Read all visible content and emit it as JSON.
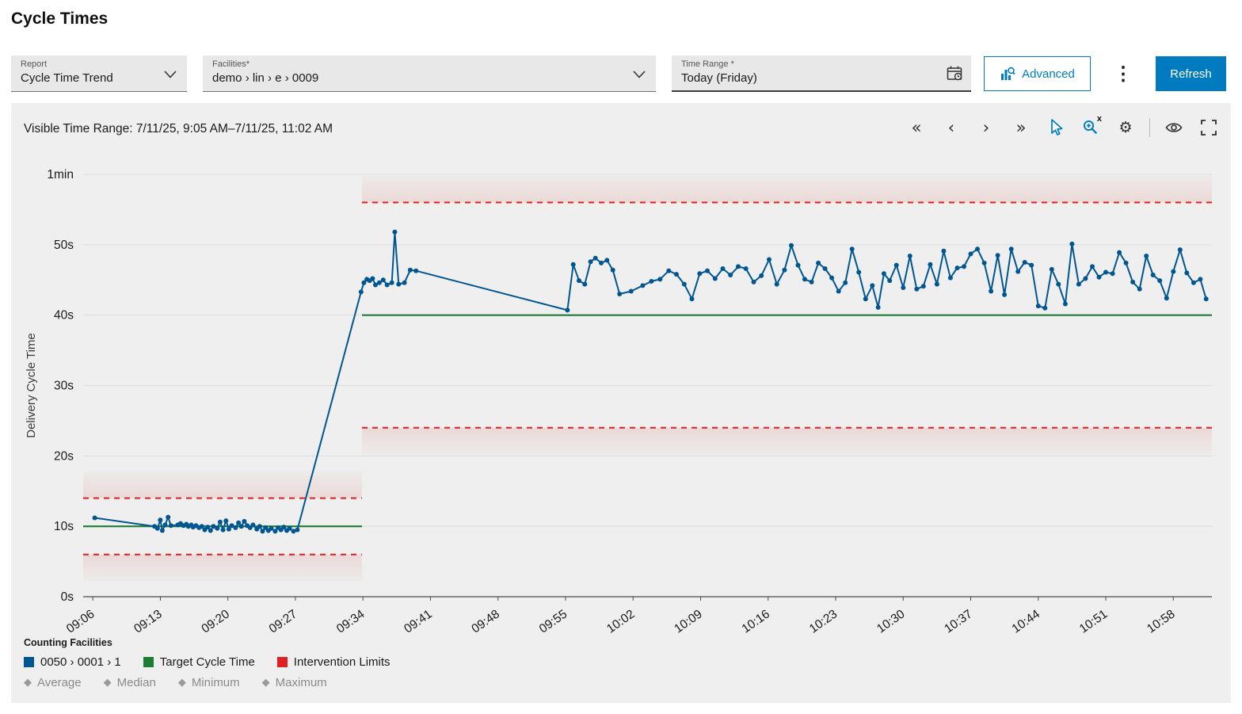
{
  "page": {
    "title": "Cycle Times"
  },
  "toolbar": {
    "report": {
      "label": "Report",
      "value": "Cycle Time Trend"
    },
    "facilities": {
      "label": "Facilities*",
      "value": "demo › lin › e › 0009"
    },
    "time_range": {
      "label": "Time Range *",
      "value": "Today (Friday)"
    },
    "advanced_label": "Advanced",
    "refresh_label": "Refresh"
  },
  "chart_header": {
    "visible_time_range": "Visible Time Range: 7/11/25, 9:05 AM–7/11/25, 11:02 AM"
  },
  "icons": {
    "pan_far_left": "«",
    "pan_left": "‹",
    "pan_right": "›",
    "pan_far_right": "»",
    "gear": "⚙",
    "more": "⋮",
    "zoom_sup": "x",
    "diamond": "◆"
  },
  "legend": {
    "title": "Counting Facilities",
    "series": [
      {
        "label": "0050 › 0001 › 1",
        "color": "#005691"
      },
      {
        "label": "Target Cycle Time",
        "color": "#1e7d34"
      },
      {
        "label": "Intervention Limits",
        "color": "#e02020"
      }
    ],
    "stats": [
      {
        "label": "Average"
      },
      {
        "label": "Median"
      },
      {
        "label": "Minimum"
      },
      {
        "label": "Maximum"
      }
    ]
  },
  "colors": {
    "series": "#005691",
    "target": "#1e7d34",
    "intervention": "#e02020",
    "grid": "#dcdcdc",
    "accent": "#007bc0",
    "panel_bg": "#efeff0"
  },
  "chart_data": {
    "type": "line",
    "title": "Cycle Time Trend",
    "ylabel": "Delivery Cycle Time",
    "ylim": [
      0,
      60
    ],
    "x_unit": "minutes after 09:00",
    "x_range": [
      5,
      122
    ],
    "grid": true,
    "y_ticks": [
      {
        "v": 0,
        "label": "0s"
      },
      {
        "v": 10,
        "label": "10s"
      },
      {
        "v": 20,
        "label": "20s"
      },
      {
        "v": 30,
        "label": "30s"
      },
      {
        "v": 40,
        "label": "40s"
      },
      {
        "v": 50,
        "label": "50s"
      },
      {
        "v": 60,
        "label": "1min"
      }
    ],
    "x_ticks": [
      {
        "t": 6,
        "label": "09:06"
      },
      {
        "t": 13,
        "label": "09:13"
      },
      {
        "t": 20,
        "label": "09:20"
      },
      {
        "t": 27,
        "label": "09:27"
      },
      {
        "t": 34,
        "label": "09:34"
      },
      {
        "t": 41,
        "label": "09:41"
      },
      {
        "t": 48,
        "label": "09:48"
      },
      {
        "t": 55,
        "label": "09:55"
      },
      {
        "t": 62,
        "label": "10:02"
      },
      {
        "t": 69,
        "label": "10:09"
      },
      {
        "t": 76,
        "label": "10:16"
      },
      {
        "t": 83,
        "label": "10:23"
      },
      {
        "t": 90,
        "label": "10:30"
      },
      {
        "t": 97,
        "label": "10:37"
      },
      {
        "t": 104,
        "label": "10:44"
      },
      {
        "t": 111,
        "label": "10:51"
      },
      {
        "t": 118,
        "label": "10:58"
      }
    ],
    "target_cycle_time": [
      {
        "from": 5,
        "to": 33.9,
        "value": 10
      },
      {
        "from": 33.9,
        "to": 122,
        "value": 40
      }
    ],
    "intervention_limits": [
      {
        "from": 5,
        "to": 33.9,
        "lower": 6,
        "upper": 14
      },
      {
        "from": 33.9,
        "to": 122,
        "lower": 24,
        "upper": 56
      }
    ],
    "series": [
      {
        "name": "0050 › 0001 › 1",
        "points": [
          [
            6.2,
            11.2
          ],
          [
            12.4,
            10.0
          ],
          [
            12.7,
            9.7
          ],
          [
            13.0,
            10.9
          ],
          [
            13.2,
            9.4
          ],
          [
            13.5,
            10.2
          ],
          [
            13.8,
            11.3
          ],
          [
            14.1,
            10.1
          ],
          [
            14.8,
            10.2
          ],
          [
            15.1,
            10.4
          ],
          [
            15.4,
            10.1
          ],
          [
            15.7,
            10.3
          ],
          [
            15.9,
            10.0
          ],
          [
            16.2,
            10.2
          ],
          [
            16.4,
            9.9
          ],
          [
            16.7,
            10.1
          ],
          [
            17.0,
            9.8
          ],
          [
            17.3,
            10.0
          ],
          [
            17.6,
            9.5
          ],
          [
            17.9,
            9.9
          ],
          [
            18.2,
            9.4
          ],
          [
            18.5,
            10.0
          ],
          [
            18.9,
            9.7
          ],
          [
            19.2,
            10.6
          ],
          [
            19.5,
            9.5
          ],
          [
            19.8,
            10.8
          ],
          [
            20.1,
            9.6
          ],
          [
            20.4,
            10.1
          ],
          [
            20.8,
            9.8
          ],
          [
            21.1,
            10.5
          ],
          [
            21.4,
            10.0
          ],
          [
            21.7,
            10.7
          ],
          [
            22.0,
            10.1
          ],
          [
            22.3,
            9.8
          ],
          [
            22.6,
            10.2
          ],
          [
            23.0,
            9.6
          ],
          [
            23.3,
            10.0
          ],
          [
            23.6,
            9.3
          ],
          [
            23.9,
            9.8
          ],
          [
            24.2,
            9.4
          ],
          [
            24.5,
            9.7
          ],
          [
            24.9,
            9.3
          ],
          [
            25.2,
            9.8
          ],
          [
            25.5,
            9.5
          ],
          [
            25.8,
            9.9
          ],
          [
            26.1,
            9.4
          ],
          [
            26.4,
            9.7
          ],
          [
            26.8,
            9.3
          ],
          [
            27.2,
            9.5
          ],
          [
            33.8,
            43.3
          ],
          [
            34.1,
            44.6
          ],
          [
            34.4,
            45.1
          ],
          [
            34.7,
            44.9
          ],
          [
            35.0,
            45.2
          ],
          [
            35.3,
            44.3
          ],
          [
            35.7,
            44.6
          ],
          [
            36.1,
            45.0
          ],
          [
            36.5,
            44.3
          ],
          [
            37.0,
            44.6
          ],
          [
            37.3,
            51.8
          ],
          [
            37.7,
            44.4
          ],
          [
            38.3,
            44.6
          ],
          [
            38.9,
            46.4
          ],
          [
            39.5,
            46.3
          ],
          [
            55.2,
            40.7
          ],
          [
            55.8,
            47.2
          ],
          [
            56.4,
            44.9
          ],
          [
            57.0,
            44.4
          ],
          [
            57.6,
            47.6
          ],
          [
            58.1,
            48.1
          ],
          [
            58.7,
            47.4
          ],
          [
            59.3,
            47.8
          ],
          [
            59.9,
            46.4
          ],
          [
            60.6,
            43.0
          ],
          [
            61.8,
            43.4
          ],
          [
            63.0,
            44.2
          ],
          [
            63.9,
            44.8
          ],
          [
            64.8,
            45.1
          ],
          [
            65.7,
            46.3
          ],
          [
            66.5,
            45.8
          ],
          [
            67.3,
            44.4
          ],
          [
            68.1,
            42.3
          ],
          [
            68.9,
            45.9
          ],
          [
            69.7,
            46.3
          ],
          [
            70.5,
            45.2
          ],
          [
            71.3,
            46.6
          ],
          [
            72.1,
            45.7
          ],
          [
            72.9,
            46.9
          ],
          [
            73.7,
            46.6
          ],
          [
            74.5,
            44.7
          ],
          [
            75.3,
            45.6
          ],
          [
            76.1,
            47.9
          ],
          [
            76.9,
            44.4
          ],
          [
            77.7,
            46.4
          ],
          [
            78.4,
            49.9
          ],
          [
            79.1,
            47.1
          ],
          [
            79.8,
            45.1
          ],
          [
            80.5,
            44.7
          ],
          [
            81.2,
            47.4
          ],
          [
            81.9,
            46.6
          ],
          [
            82.6,
            45.3
          ],
          [
            83.3,
            43.4
          ],
          [
            84.0,
            44.6
          ],
          [
            84.7,
            49.4
          ],
          [
            85.4,
            46.1
          ],
          [
            86.1,
            42.3
          ],
          [
            86.8,
            44.2
          ],
          [
            87.4,
            41.1
          ],
          [
            88.0,
            45.9
          ],
          [
            88.6,
            44.9
          ],
          [
            89.3,
            47.1
          ],
          [
            90.0,
            43.9
          ],
          [
            90.7,
            48.4
          ],
          [
            91.4,
            43.7
          ],
          [
            92.1,
            44.1
          ],
          [
            92.8,
            47.2
          ],
          [
            93.5,
            44.4
          ],
          [
            94.2,
            49.1
          ],
          [
            94.9,
            45.3
          ],
          [
            95.6,
            46.7
          ],
          [
            96.3,
            46.9
          ],
          [
            97.0,
            48.7
          ],
          [
            97.7,
            49.4
          ],
          [
            98.4,
            47.4
          ],
          [
            99.1,
            43.4
          ],
          [
            99.8,
            48.5
          ],
          [
            100.5,
            42.9
          ],
          [
            101.2,
            49.4
          ],
          [
            101.9,
            46.2
          ],
          [
            102.6,
            47.5
          ],
          [
            103.3,
            47.1
          ],
          [
            104.0,
            41.3
          ],
          [
            104.7,
            41.0
          ],
          [
            105.4,
            46.5
          ],
          [
            106.1,
            44.4
          ],
          [
            106.8,
            41.6
          ],
          [
            107.5,
            50.1
          ],
          [
            108.2,
            44.4
          ],
          [
            108.9,
            45.2
          ],
          [
            109.6,
            46.9
          ],
          [
            110.3,
            45.4
          ],
          [
            111.0,
            46.1
          ],
          [
            111.7,
            45.9
          ],
          [
            112.4,
            48.9
          ],
          [
            113.1,
            47.4
          ],
          [
            113.8,
            44.7
          ],
          [
            114.5,
            43.7
          ],
          [
            115.2,
            48.4
          ],
          [
            115.9,
            45.7
          ],
          [
            116.6,
            44.9
          ],
          [
            117.3,
            42.4
          ],
          [
            118.0,
            46.2
          ],
          [
            118.7,
            49.3
          ],
          [
            119.4,
            46.0
          ],
          [
            120.1,
            44.6
          ],
          [
            120.8,
            45.1
          ],
          [
            121.4,
            42.3
          ]
        ]
      }
    ]
  }
}
